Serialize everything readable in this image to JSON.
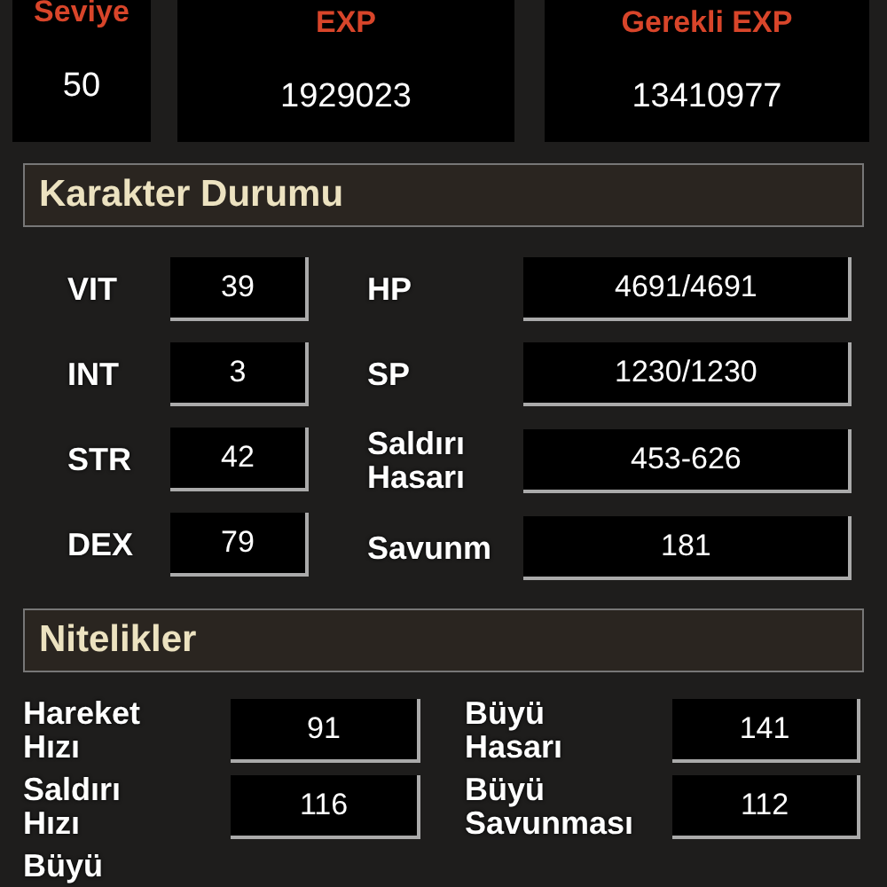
{
  "summary": [
    {
      "label": "Seviye",
      "value": "50"
    },
    {
      "label": "EXP",
      "value": "1929023"
    },
    {
      "label": "Gerekli EXP",
      "value": "13410977"
    }
  ],
  "character_status": {
    "title": "Karakter Durumu",
    "stats": [
      {
        "label": "VIT",
        "value": "39"
      },
      {
        "label": "INT",
        "value": "3"
      },
      {
        "label": "STR",
        "value": "42"
      },
      {
        "label": "DEX",
        "value": "79"
      }
    ],
    "details": [
      {
        "label": "HP",
        "value": "4691/4691"
      },
      {
        "label": "SP",
        "value": "1230/1230"
      },
      {
        "label": "Saldırı Hasarı",
        "value": "453-626"
      },
      {
        "label": "Savunm",
        "value": "181"
      }
    ]
  },
  "attributes": {
    "title": "Nitelikler",
    "left": [
      {
        "label": "Hareket Hızı",
        "value": "91"
      },
      {
        "label": "Saldırı Hızı",
        "value": "116"
      },
      {
        "label": "Büyü"
      }
    ],
    "right": [
      {
        "label": "Büyü Hasarı",
        "value": "141"
      },
      {
        "label": "Büyü Savunması",
        "value": "112"
      }
    ]
  }
}
